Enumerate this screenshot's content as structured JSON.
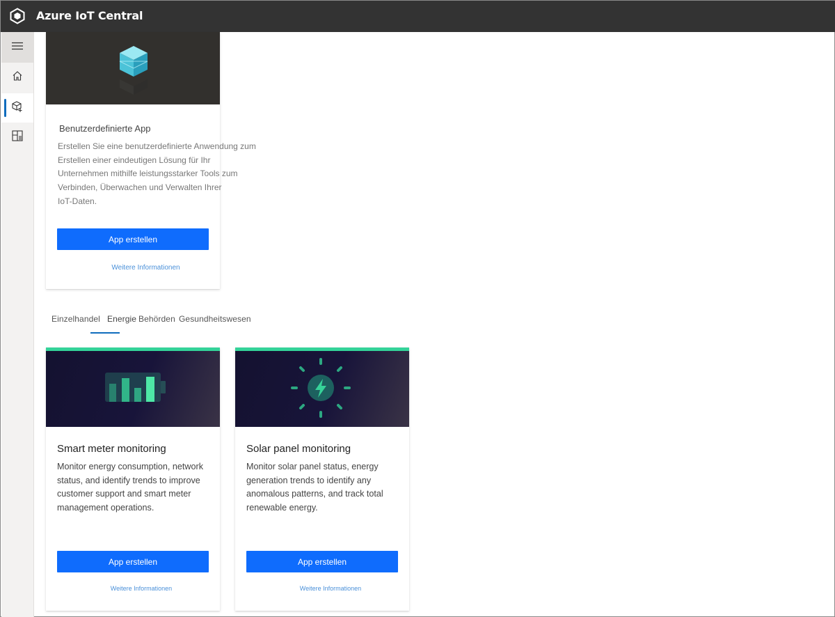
{
  "topbar": {
    "title": "Azure IoT Central",
    "logo_icon": "hexagon-logo-icon"
  },
  "sidebar": {
    "items": [
      {
        "name": "menu",
        "icon": "hamburger-icon"
      },
      {
        "name": "home",
        "icon": "home-icon"
      },
      {
        "name": "build",
        "icon": "build-cube-icon",
        "active": true
      },
      {
        "name": "my-apps",
        "icon": "apps-grid-icon"
      }
    ]
  },
  "custom_app": {
    "title": "Benutzerdefinierte App",
    "description_lines": [
      "Erstellen Sie eine benutzerdefinierte Anwendung zum",
      "Erstellen einer eindeutigen Lösung für Ihr",
      "Unternehmen mithilfe leistungsstarker Tools zum",
      "Verbinden, Überwachen und Verwalten Ihrer",
      "IoT-Daten."
    ],
    "button_label": "App erstellen",
    "link_label": "Weitere Informationen"
  },
  "tabs": [
    {
      "label": "Einzelhandel"
    },
    {
      "label": "Energie",
      "selected": true
    },
    {
      "label": "Behörden"
    },
    {
      "label": "Gesundheitswesen"
    }
  ],
  "templates": [
    {
      "title": "Smart meter monitoring",
      "description": "Monitor energy consumption, network status, and identify trends to improve customer support and smart meter management operations.",
      "button_label": "App erstellen",
      "link_label": "Weitere Informationen"
    },
    {
      "title": "Solar panel monitoring",
      "description": "Monitor solar panel status, energy generation trends to identify any anomalous patterns, and track total renewable energy.",
      "button_label": "App erstellen",
      "link_label": "Weitere Informationen"
    }
  ],
  "colors": {
    "accent": "#0f6cfd",
    "topbar": "#333333",
    "energy_accent": "#34d399"
  }
}
